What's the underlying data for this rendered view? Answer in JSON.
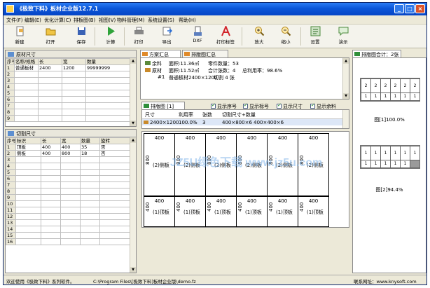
{
  "window": {
    "title": "《极致下料》板材企业版12.7.1"
  },
  "menu": [
    "文件(F)",
    "编辑(E)",
    "优化计算(C)",
    "排板图(B)",
    "视图(V)",
    "物料管理(M)",
    "系统设置(S)",
    "帮助(H)"
  ],
  "toolbar": {
    "new": "新建",
    "open": "打开",
    "save": "保存",
    "calc": "计算",
    "print": "打印",
    "export": "导出",
    "dxf": "DXF",
    "print_label": "打印标签",
    "zoom_in": "放大",
    "zoom_out": "缩小",
    "settings": "设置",
    "demo": "演示"
  },
  "raw_panel": {
    "title": "原材尺寸",
    "headers": [
      "序号",
      "名称/规格",
      "长",
      "宽",
      "数量"
    ],
    "rows": [
      [
        "1",
        "普通板材",
        "2400",
        "1200",
        "99999999"
      ],
      [
        "2"
      ],
      [
        "3"
      ],
      [
        "4"
      ],
      [
        "5"
      ],
      [
        "6"
      ],
      [
        "7"
      ],
      [
        "8"
      ],
      [
        "9"
      ]
    ]
  },
  "cut_panel": {
    "title": "切割尺寸",
    "headers": [
      "序号",
      "标识",
      "长",
      "宽",
      "数量",
      "旋转"
    ],
    "rows": [
      [
        "1",
        "顶板",
        "400",
        "400",
        "35",
        "否"
      ],
      [
        "2",
        "侧板",
        "400",
        "800",
        "18",
        "否"
      ],
      [
        "3"
      ],
      [
        "4"
      ],
      [
        "5"
      ],
      [
        "6"
      ],
      [
        "7"
      ],
      [
        "8"
      ],
      [
        "9"
      ],
      [
        "10"
      ],
      [
        "11"
      ],
      [
        "12"
      ],
      [
        "13"
      ],
      [
        "14"
      ],
      [
        "15"
      ],
      [
        "16"
      ]
    ]
  },
  "plan": {
    "tab1": "方案汇总",
    "tab2": "排版图汇总",
    "row1_label": "余料",
    "row1_area": "面积:11.36㎡",
    "row1_parts": "零件数量：53",
    "row2_label": "原材",
    "row2_area": "面积:11.52㎡",
    "row2_sheets": "合计张数：4",
    "row2_util": "总利用率：98.6%",
    "row3_no": "#1",
    "row3_name": "普通板材2400×1200",
    "row3_count": "切割 4 张"
  },
  "layout": {
    "tab": "排版图 [1]",
    "checks": [
      "显示序号",
      "显示标号",
      "显示尺寸",
      "显示余料"
    ],
    "headers": [
      "尺寸",
      "利用率",
      "张数",
      "切割尺寸+数量"
    ],
    "row": [
      "2400×1200",
      "100.0%",
      "3",
      "400×800×6  400×400×6"
    ],
    "top_cells": [
      {
        "w": "400",
        "h": "800",
        "name": "(2)侧板"
      },
      {
        "w": "400",
        "h": "800",
        "name": "(2)侧板"
      },
      {
        "w": "400",
        "h": "800",
        "name": "(2)侧板"
      },
      {
        "w": "400",
        "h": "800",
        "name": "(2)侧板"
      },
      {
        "w": "400",
        "h": "800",
        "name": "(2)侧板"
      },
      {
        "w": "400",
        "h": "800",
        "name": "(2)侧板"
      }
    ],
    "bottom_cells": [
      {
        "w": "400",
        "h": "400",
        "name": "(1)顶板"
      },
      {
        "w": "400",
        "h": "400",
        "name": "(1)顶板"
      },
      {
        "w": "400",
        "h": "400",
        "name": "(1)顶板"
      },
      {
        "w": "400",
        "h": "400",
        "name": "(1)顶板"
      },
      {
        "w": "400",
        "h": "400",
        "name": "(1)顶板"
      },
      {
        "w": "400",
        "h": "400",
        "name": "(1)顶板"
      }
    ]
  },
  "thumbs": {
    "title": "排版图合计：2张",
    "thumb1_top": [
      "2",
      "2",
      "2",
      "2",
      "2",
      "2"
    ],
    "thumb1_bottom": [
      "1",
      "1",
      "1",
      "1",
      "1",
      "1"
    ],
    "thumb1_label": "图[1]100.0%",
    "thumb2_top": [
      "1",
      "1",
      "1",
      "1",
      "1",
      "1"
    ],
    "thumb2_bottom": [
      "1",
      "1",
      "1",
      "1",
      "1"
    ],
    "thumb2_label": "图[2]94.4%"
  },
  "watermark": "JZ5U绿色下载 www.jz5u.com",
  "status": {
    "left": "欢迎使用《极致下料》系列软件。",
    "path": "C:\\Program Files\\[极致下料]板材企业版\\demo.fz",
    "right": "联系网址：www.knysoft.com"
  }
}
